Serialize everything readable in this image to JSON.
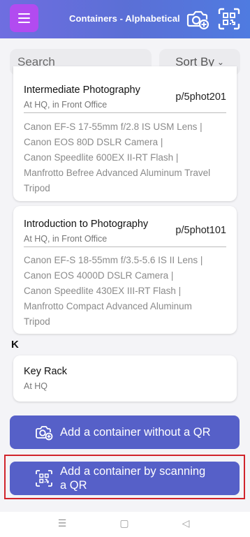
{
  "header": {
    "title": "Containers - Alphabetical",
    "menu_icon": "hamburger-icon",
    "camera_icon": "camera-add-icon",
    "qr_icon": "qr-scan-icon"
  },
  "toolbar": {
    "search_placeholder": "Search",
    "sort_label": "Sort By",
    "sort_chevron": "⌄"
  },
  "containers": [
    {
      "title": "Intermediate Photography",
      "location": "At HQ, in Front Office",
      "code": "p/5phot201",
      "items": [
        "Canon EF-S 17-55mm f/2.8 IS USM Lens |",
        "Canon EOS 80D DSLR Camera |",
        "Canon Speedlite 600EX II-RT Flash |",
        "Manfrotto Befree Advanced Aluminum Travel",
        "Tripod"
      ]
    },
    {
      "title": "Introduction to Photography",
      "location": "At HQ, in Front Office",
      "code": "p/5phot101",
      "items": [
        "Canon EF-S 18-55mm f/3.5-5.6 IS II Lens |",
        "Canon EOS 4000D DSLR Camera |",
        "Canon Speedlite 430EX III-RT Flash |",
        "Manfrotto Compact Advanced Aluminum",
        "Tripod"
      ]
    }
  ],
  "section_k": {
    "letter": "K",
    "container": {
      "title": "Key Rack",
      "location": "At HQ"
    }
  },
  "actions": {
    "add_without_qr": "Add a container without a QR",
    "add_by_scanning_line1": "Add a container by scanning",
    "add_by_scanning_line2": "a QR"
  },
  "system_nav": {
    "menu_glyph": "☰",
    "home_glyph": "▢",
    "back_glyph": "◁"
  },
  "colors": {
    "header_gradient_start": "#6f6ee0",
    "header_gradient_end": "#4f7be0",
    "menu_button": "#b24bf0",
    "action_button": "#5660c8",
    "highlight": "#d1242b"
  }
}
